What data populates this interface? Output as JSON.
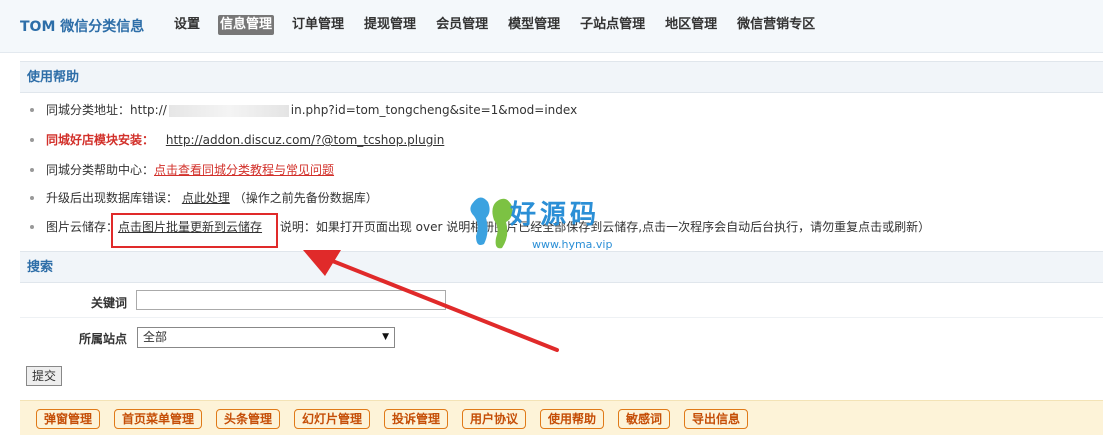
{
  "header": {
    "brand": "TOM 微信分类信息",
    "nav": [
      "设置",
      "信息管理",
      "订单管理",
      "提现管理",
      "会员管理",
      "模型管理",
      "子站点管理",
      "地区管理",
      "微信营销专区"
    ],
    "active_nav": "信息管理"
  },
  "help": {
    "title": "使用帮助",
    "row1": {
      "label": "同城分类地址：",
      "url_prefix": "http://",
      "url_suffix": "in.php?id=tom_tongcheng&site=1&mod=index"
    },
    "row2": {
      "label": "同城好店模块安装：",
      "link": "http://addon.discuz.com/?@tom_tcshop.plugin"
    },
    "row3": {
      "label": "同城分类帮助中心：",
      "link": "点击查看同城分类教程与常见问题"
    },
    "row4": {
      "label": "升级后出现数据库错误：",
      "link": "点此处理",
      "note": "（操作之前先备份数据库）"
    },
    "row5": {
      "label": "图片云储存：",
      "link": "点击图片批量更新到云储存",
      "note": "说明：如果打开页面出现 over 说明相册图片已经全部保存到云储存,点击一次程序会自动后台执行，请勿重复点击或刷新）"
    }
  },
  "search": {
    "title": "搜索",
    "keyword_label": "关键词",
    "keyword_value": "",
    "site_label": "所属站点",
    "site_value": "全部",
    "submit": "提交"
  },
  "actions": [
    "弹窗管理",
    "首页菜单管理",
    "头条管理",
    "幻灯片管理",
    "投诉管理",
    "用户协议",
    "使用帮助",
    "敏感词",
    "导出信息"
  ],
  "watermark": {
    "text": "好源码",
    "url": "www.hyma.vip"
  },
  "colors": {
    "brand": "#2d6ea8",
    "red": "#d2302a",
    "orange": "#e07a18",
    "annotation": "#e02a2a"
  }
}
